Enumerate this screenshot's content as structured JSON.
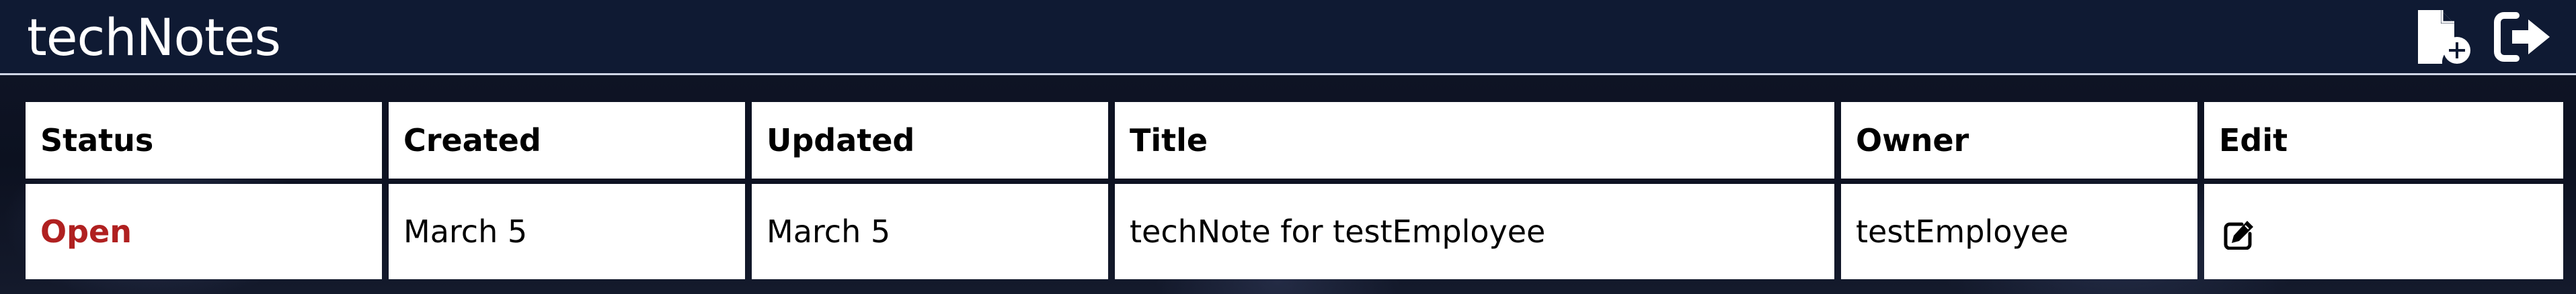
{
  "app": {
    "title": "techNotes"
  },
  "header": {
    "icons": {
      "new_note": "file-plus-icon",
      "logout": "sign-out-icon"
    }
  },
  "table": {
    "columns": [
      "Status",
      "Created",
      "Updated",
      "Title",
      "Owner",
      "Edit"
    ],
    "rows": [
      {
        "status": "Open",
        "created": "March 5",
        "updated": "March 5",
        "title": "techNote for testEmployee",
        "owner": "testEmployee",
        "edit_icon": "pen-to-square-icon"
      }
    ]
  },
  "colors": {
    "header_bg": "#0f1a33",
    "status_open": "#b02020",
    "cell_bg": "#ffffff"
  }
}
